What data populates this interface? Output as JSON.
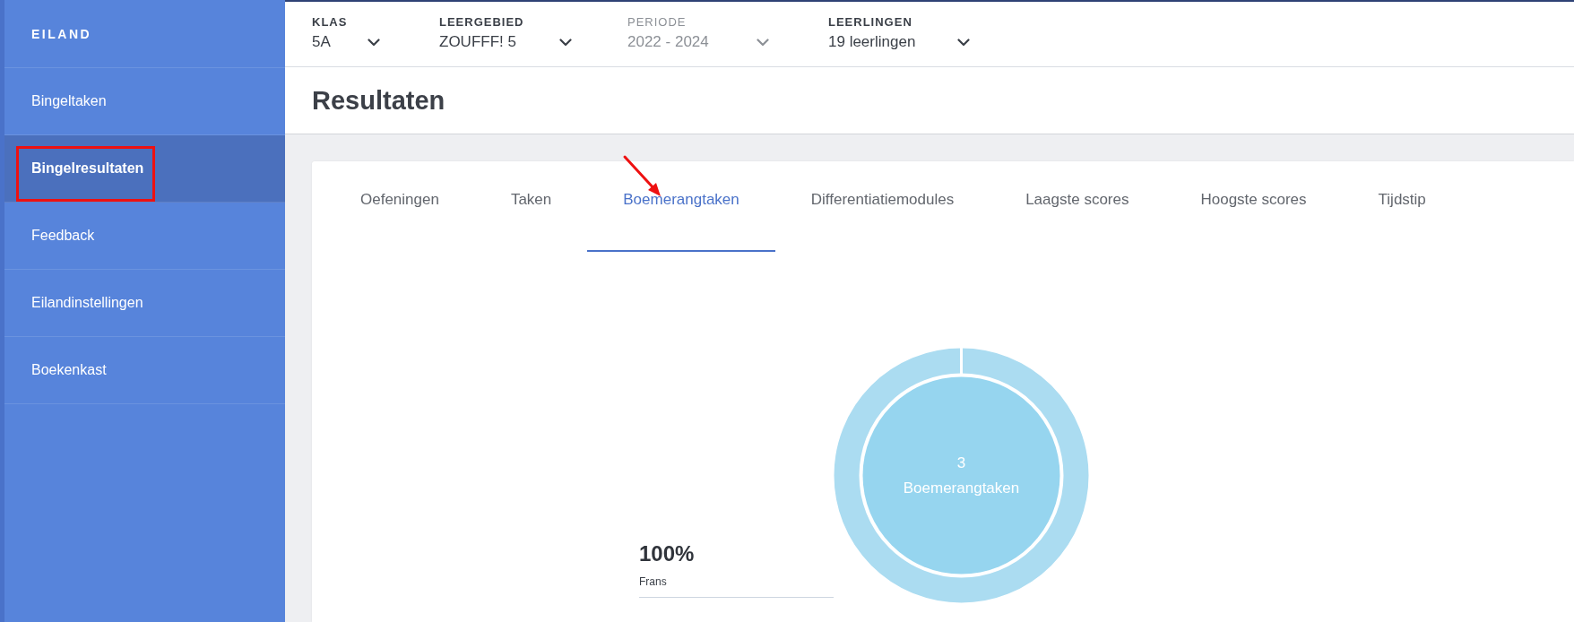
{
  "sidebar": {
    "brand": "EILAND",
    "items": [
      {
        "label": "Bingeltaken",
        "selected": false
      },
      {
        "label": "Bingelresultaten",
        "selected": true
      },
      {
        "label": "Feedback",
        "selected": false
      },
      {
        "label": "Eilandinstellingen",
        "selected": false
      },
      {
        "label": "Boekenkast",
        "selected": false
      }
    ]
  },
  "filters": [
    {
      "label": "KLAS",
      "value": "5A",
      "disabled": false
    },
    {
      "label": "LEERGEBIED",
      "value": "ZOUFFF! 5",
      "disabled": false
    },
    {
      "label": "PERIODE",
      "value": "2022 - 2024",
      "disabled": true
    },
    {
      "label": "LEERLINGEN",
      "value": "19 leerlingen",
      "disabled": false
    }
  ],
  "page_title": "Resultaten",
  "tabs": [
    {
      "label": "Oefeningen",
      "selected": false
    },
    {
      "label": "Taken",
      "selected": false
    },
    {
      "label": "Boemerangtaken",
      "selected": true
    },
    {
      "label": "Differentiatiemodules",
      "selected": false
    },
    {
      "label": "Laagste scores",
      "selected": false
    },
    {
      "label": "Hoogste scores",
      "selected": false
    },
    {
      "label": "Tijdstip",
      "selected": false
    }
  ],
  "summary": {
    "percentage": "100%",
    "subject": "Frans"
  },
  "donut": {
    "count": "3",
    "label": "Boemerangtaken"
  }
}
